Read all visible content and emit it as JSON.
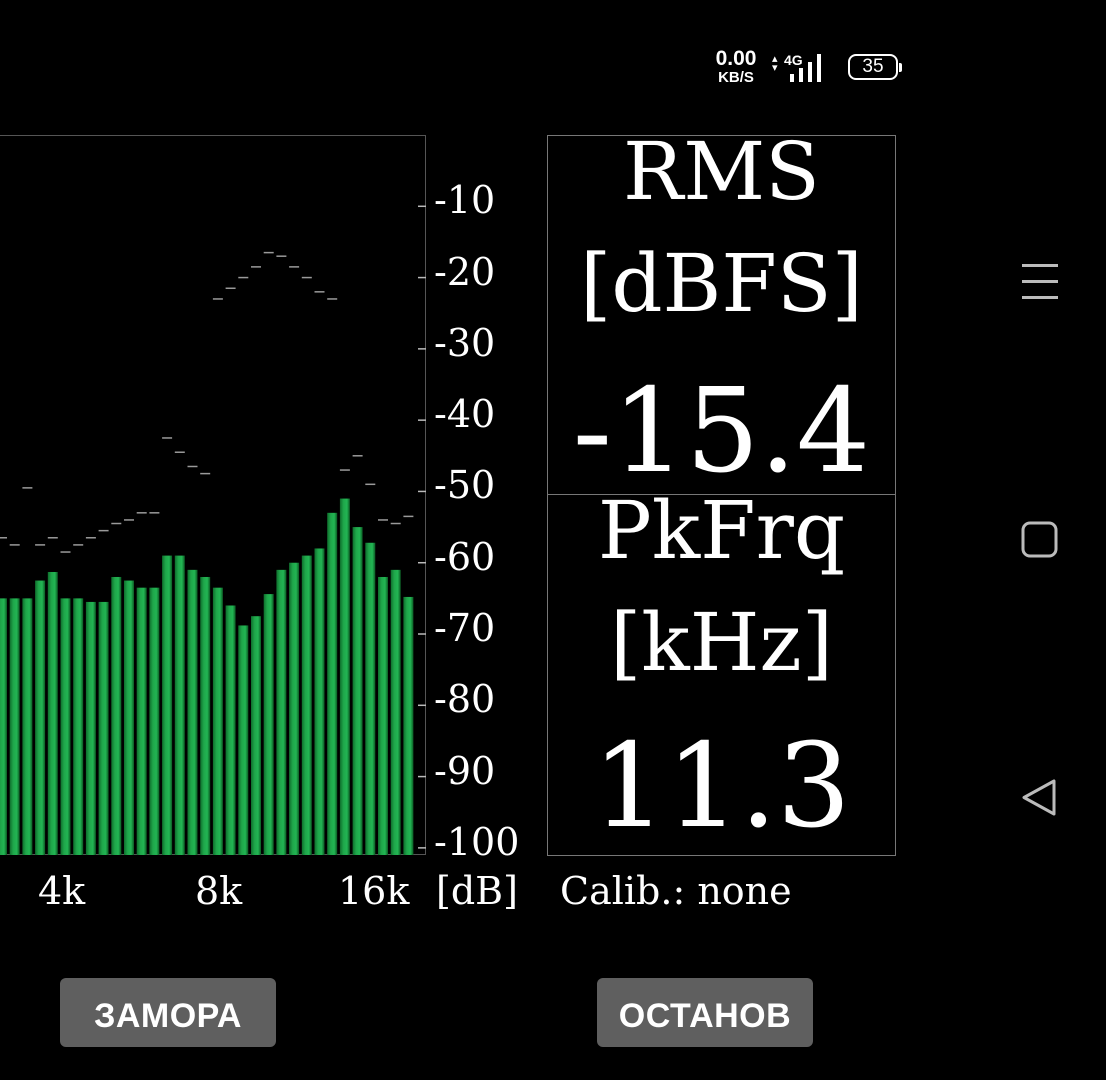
{
  "status_bar": {
    "net_speed": "0.00",
    "net_speed_unit": "KB/S",
    "network_type": "4G",
    "battery": "35"
  },
  "spectrum": {
    "y_ticks": [
      "-10",
      "-20",
      "-30",
      "-40",
      "-50",
      "-60",
      "-70",
      "-80",
      "-90",
      "-100"
    ],
    "x_ticks": [
      "4k",
      "8k",
      "16k"
    ],
    "unit": "[dB]",
    "y_range_db": [
      0,
      -101
    ],
    "bar_color": "#1fa64a",
    "bars_db": [
      -65,
      -65,
      -65,
      -62.5,
      -61.3,
      -65,
      -65,
      -65.5,
      -65.5,
      -62,
      -62.5,
      -63.5,
      -63.5,
      -59,
      -59,
      -61,
      -62,
      -63.5,
      -66,
      -68.8,
      -67.5,
      -64.4,
      -61,
      -60,
      -59,
      -58,
      -53,
      -51,
      -55,
      -57.2,
      -62,
      -61,
      -64.8
    ],
    "peaks_db": [
      -56.5,
      -57.5,
      -49.5,
      -57.5,
      -56.5,
      -58.5,
      -57.5,
      -56.5,
      -55.5,
      -54.5,
      -54,
      -53,
      -53,
      -42.5,
      -44.5,
      -46.5,
      -47.5,
      -23,
      -21.5,
      -20,
      -18.5,
      -16.5,
      -17,
      -18.5,
      -20,
      -22,
      -23,
      -47,
      -45,
      -49,
      -54,
      -54.5,
      -53.5
    ]
  },
  "readouts": {
    "rms_label": "RMS",
    "rms_unit": "[dBFS]",
    "rms_value": "-15.4",
    "pk_label": "PkFrq",
    "pk_unit": "[kHz]",
    "pk_value": "11.3"
  },
  "calibration": "Calib.: none",
  "buttons": {
    "freeze": "ЗАМОРА",
    "stop": "ОСТАНОВ"
  }
}
